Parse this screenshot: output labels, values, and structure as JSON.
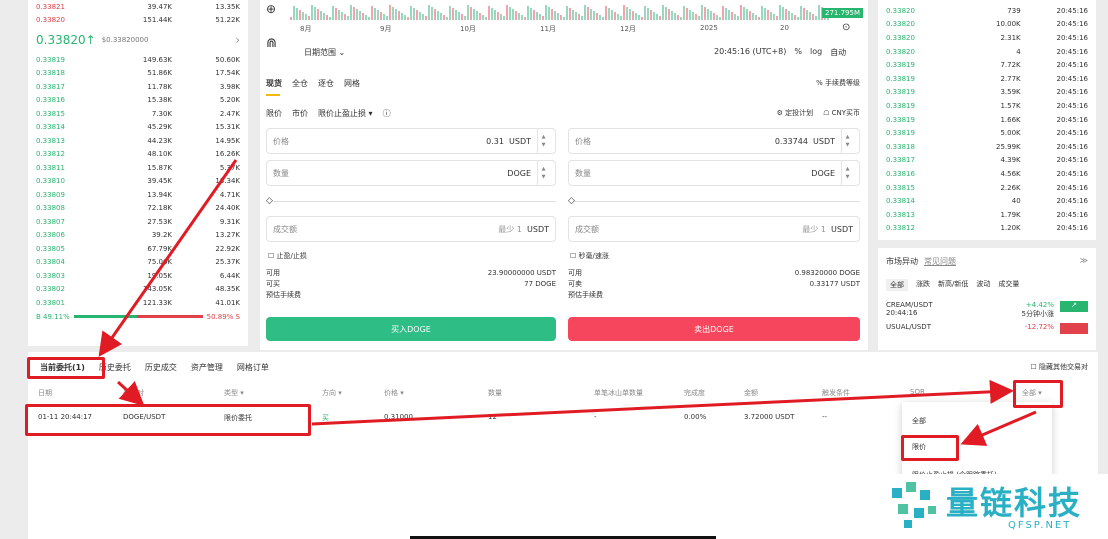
{
  "orderbook_left": {
    "asks": [
      [
        "0.33821",
        "39.47K",
        "13.35K"
      ],
      [
        "0.33820",
        "151.44K",
        "51.22K"
      ]
    ],
    "mid_price": "0.33820",
    "mid_arrow": "↑",
    "mid_sub": "$0.33820000",
    "mid_more": "›",
    "bids": [
      [
        "0.33819",
        "149.63K",
        "50.60K"
      ],
      [
        "0.33818",
        "51.86K",
        "17.54K"
      ],
      [
        "0.33817",
        "11.78K",
        "3.98K"
      ],
      [
        "0.33816",
        "15.38K",
        "5.20K"
      ],
      [
        "0.33815",
        "7.30K",
        "2.47K"
      ],
      [
        "0.33814",
        "45.29K",
        "15.31K"
      ],
      [
        "0.33813",
        "44.23K",
        "14.95K"
      ],
      [
        "0.33812",
        "48.10K",
        "16.26K"
      ],
      [
        "0.33811",
        "15.87K",
        "5.37K"
      ],
      [
        "0.33810",
        "39.45K",
        "13.34K"
      ],
      [
        "0.33809",
        "13.94K",
        "4.71K"
      ],
      [
        "0.33808",
        "72.18K",
        "24.40K"
      ],
      [
        "0.33807",
        "27.53K",
        "9.31K"
      ],
      [
        "0.33806",
        "39.2K",
        "13.27K"
      ],
      [
        "0.33805",
        "67.79K",
        "22.92K"
      ],
      [
        "0.33804",
        "75.06K",
        "25.37K"
      ],
      [
        "0.33803",
        "19.05K",
        "6.44K"
      ],
      [
        "0.33802",
        "143.05K",
        "48.35K"
      ],
      [
        "0.33801",
        "121.33K",
        "41.01K"
      ]
    ],
    "ratio_buy": "B 49.11%",
    "ratio_sell": "50.89% S",
    "ratio_buy_value": 0.4911
  },
  "chart": {
    "zoom_icon": "zoom-icon",
    "months": [
      "8月",
      "9月",
      "10月",
      "11月",
      "12月",
      "2025",
      "20"
    ],
    "volume_tag": "271.795M",
    "date_range": "日期范围",
    "time": "20:45:16 (UTC+8)",
    "pct": "%",
    "log": "log",
    "auto": "自动"
  },
  "trade": {
    "tabs": [
      "现货",
      "全仓",
      "逐仓",
      "网格"
    ],
    "fee_label": "手续费等级",
    "order_types": [
      "限价",
      "市价",
      "限价止盈止损"
    ],
    "schedule": "定投计划",
    "cny": "CNY买币",
    "buy": {
      "price_label": "价格",
      "price_value": "0.31",
      "price_unit": "USDT",
      "qty_label": "数量",
      "qty_unit": "DOGE",
      "total_label": "成交额",
      "total_min": "最少 1",
      "total_unit": "USDT",
      "tpsl": "止盈/止损",
      "avail_label": "可用",
      "avail_value": "23.90000000 USDT",
      "can_buy_label": "可买",
      "can_buy_value": "77 DOGE",
      "fee_est": "预估手续费",
      "button": "买入DOGE"
    },
    "sell": {
      "price_label": "价格",
      "price_value": "0.33744",
      "price_unit": "USDT",
      "qty_label": "数量",
      "qty_unit": "DOGE",
      "total_label": "成交额",
      "total_min": "最少 1",
      "total_unit": "USDT",
      "tpsl": "秒毫/速涨",
      "avail_label": "可用",
      "avail_value": "0.98320000 DOGE",
      "can_sell_label": "可卖",
      "can_sell_value": "0.33177 USDT",
      "fee_est": "预估手续费",
      "button": "卖出DOGE"
    }
  },
  "orderbook_right": {
    "rows": [
      [
        "0.33820",
        "739",
        "20:45:16"
      ],
      [
        "0.33820",
        "10.00K",
        "20:45:16"
      ],
      [
        "0.33820",
        "2.31K",
        "20:45:16"
      ],
      [
        "0.33820",
        "4",
        "20:45:16"
      ],
      [
        "0.33819",
        "7.72K",
        "20:45:16"
      ],
      [
        "0.33819",
        "2.77K",
        "20:45:16"
      ],
      [
        "0.33819",
        "3.59K",
        "20:45:16"
      ],
      [
        "0.33819",
        "1.57K",
        "20:45:16"
      ],
      [
        "0.33819",
        "1.66K",
        "20:45:16"
      ],
      [
        "0.33819",
        "5.00K",
        "20:45:16"
      ],
      [
        "0.33818",
        "25.99K",
        "20:45:16"
      ],
      [
        "0.33817",
        "4.39K",
        "20:45:16"
      ],
      [
        "0.33816",
        "4.56K",
        "20:45:16"
      ],
      [
        "0.33815",
        "2.26K",
        "20:45:16"
      ],
      [
        "0.33814",
        "40",
        "20:45:16"
      ],
      [
        "0.33813",
        "1.79K",
        "20:45:16"
      ],
      [
        "0.33812",
        "1.20K",
        "20:45:16"
      ]
    ]
  },
  "market": {
    "title": "市场异动",
    "link": "常见问题",
    "chips": [
      "全部",
      "涨跌",
      "新高/新低",
      "波动",
      "成交量"
    ],
    "items": [
      {
        "pair": "CREAM/USDT",
        "time": "20:44:16",
        "change": "+4.42%",
        "desc": "5分钟小涨"
      },
      {
        "pair": "USUAL/USDT",
        "time": "",
        "change": "-12.72%",
        "desc": ""
      }
    ]
  },
  "orders": {
    "tabs": [
      "当前委托(1)",
      "历史委托",
      "历史成交",
      "资产管理",
      "网格订单"
    ],
    "hide_others": "隐藏其他交易对",
    "headers": [
      "日期",
      "交易对",
      "类型",
      "方向",
      "价格",
      "数量",
      "单笔冰山单数量",
      "完成度",
      "金额",
      "触发条件",
      "SOR",
      "全部"
    ],
    "row": {
      "date": "01-11 20:44:17",
      "pair": "DOGE/USDT",
      "type": "限价委托",
      "side": "买",
      "price": "0.31000",
      "qty": "12",
      "iceberg": "-",
      "filled": "0.00%",
      "amount": "3.72000 USDT",
      "trigger": "--"
    },
    "dropdown": [
      "全部",
      "限价",
      "限价止盈止损 (含跟踪委托)"
    ]
  },
  "watermark": {
    "text": "量链科技",
    "sub": "QFSP.NET"
  },
  "colors": {
    "buy": "#2ebd85",
    "sell": "#f6465d",
    "highlight": "#e01b24",
    "accent": "#f0b90b"
  }
}
